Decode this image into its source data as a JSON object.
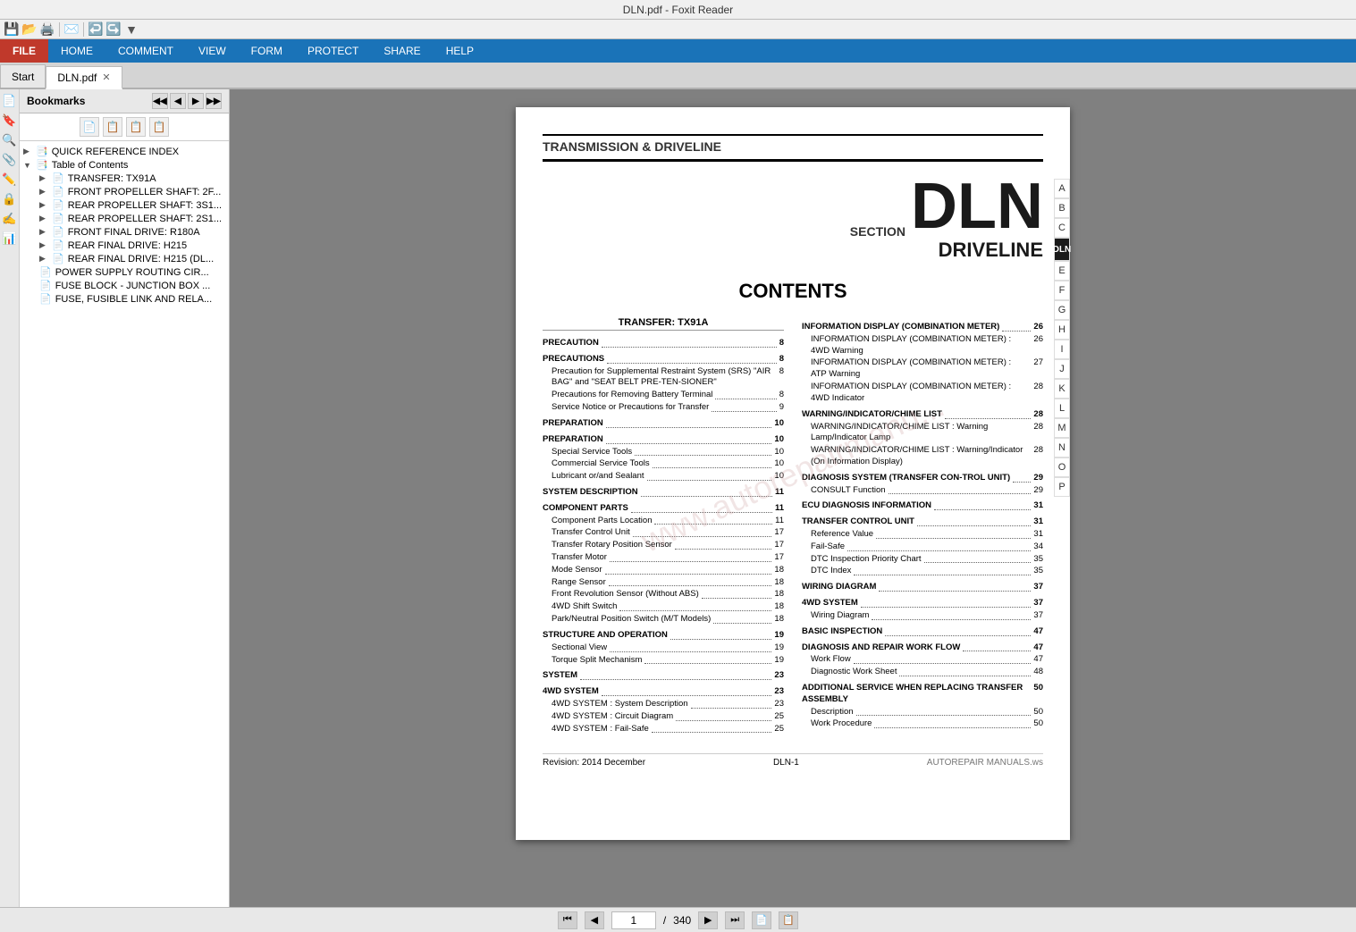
{
  "titleBar": {
    "text": "DLN.pdf - Foxit Reader"
  },
  "quickToolbar": {
    "icons": [
      "💾",
      "📂",
      "🖨️",
      "✉️",
      "↩️",
      "↪️",
      "▼"
    ]
  },
  "ribbon": {
    "file": "FILE",
    "tabs": [
      "HOME",
      "COMMENT",
      "VIEW",
      "FORM",
      "PROTECT",
      "SHARE",
      "HELP"
    ]
  },
  "tabs": [
    {
      "label": "Start",
      "active": false
    },
    {
      "label": "DLN.pdf",
      "active": true,
      "closeable": true
    }
  ],
  "sidebar": {
    "title": "Bookmarks",
    "navButtons": [
      "◀◀",
      "◀",
      "▶",
      "▶▶"
    ],
    "tools": [
      [
        "📄",
        "📋",
        "📋",
        "📋"
      ],
      []
    ],
    "tree": [
      {
        "indent": 0,
        "icon": "📑",
        "label": "QUICK REFERENCE INDEX",
        "expanded": false
      },
      {
        "indent": 0,
        "icon": "📑",
        "label": "Table of Contents",
        "expanded": true
      },
      {
        "indent": 1,
        "icon": "📄",
        "label": "TRANSFER: TX91A"
      },
      {
        "indent": 1,
        "icon": "📄",
        "label": "FRONT PROPELLER SHAFT: 2F..."
      },
      {
        "indent": 1,
        "icon": "📄",
        "label": "REAR PROPELLER SHAFT: 3S1..."
      },
      {
        "indent": 1,
        "icon": "📄",
        "label": "REAR PROPELLER SHAFT: 2S1..."
      },
      {
        "indent": 1,
        "icon": "📄",
        "label": "FRONT FINAL DRIVE: R180A"
      },
      {
        "indent": 1,
        "icon": "📄",
        "label": "REAR FINAL DRIVE: H215"
      },
      {
        "indent": 1,
        "icon": "📄",
        "label": "REAR FINAL DRIVE: H215 (DL..."
      },
      {
        "indent": 1,
        "icon": "📄",
        "label": "POWER SUPPLY ROUTING CIR..."
      },
      {
        "indent": 1,
        "icon": "📄",
        "label": "FUSE BLOCK - JUNCTION BOX ..."
      },
      {
        "indent": 1,
        "icon": "📄",
        "label": "FUSE, FUSIBLE LINK AND RELA..."
      }
    ]
  },
  "iconBar": {
    "icons": [
      "📄",
      "🔖",
      "🔍",
      "📎",
      "✏️",
      "🔒",
      "✍️",
      "📊"
    ]
  },
  "pdf": {
    "sectionLabel": "TRANSMISSION & DRIVELINE",
    "sectionWord": "SECTION",
    "dln": "DLN",
    "driveline": "DRIVELINE",
    "watermark": "www.autorepairmanu...",
    "contentsTitle": "CONTENTS",
    "rightLetters": [
      "A",
      "B",
      "C",
      "DLN",
      "E",
      "F",
      "G",
      "H",
      "I",
      "J",
      "K",
      "L",
      "M",
      "N",
      "O",
      "P"
    ],
    "leftCol": {
      "header": "TRANSFER: TX91A",
      "entries": [
        {
          "type": "main",
          "text": "PRECAUTION",
          "page": "8"
        },
        {
          "type": "main",
          "text": "PRECAUTIONS",
          "page": "8"
        },
        {
          "type": "sub",
          "text": "Precaution for Supplemental Restraint System (SRS) \"AIR BAG\" and \"SEAT BELT PRE-TEN-SIONER\"",
          "page": "8"
        },
        {
          "type": "sub",
          "text": "Precautions for Removing Battery Terminal",
          "page": "8"
        },
        {
          "type": "sub",
          "text": "Service Notice or Precautions for Transfer",
          "page": "9"
        },
        {
          "type": "main",
          "text": "PREPARATION",
          "page": "10"
        },
        {
          "type": "main",
          "text": "PREPARATION",
          "page": "10"
        },
        {
          "type": "sub",
          "text": "Special Service Tools",
          "page": "10"
        },
        {
          "type": "sub",
          "text": "Commercial Service Tools",
          "page": "10"
        },
        {
          "type": "sub",
          "text": "Lubricant or/and Sealant",
          "page": "10"
        },
        {
          "type": "main",
          "text": "SYSTEM DESCRIPTION",
          "page": "11"
        },
        {
          "type": "main",
          "text": "COMPONENT PARTS",
          "page": "11"
        },
        {
          "type": "sub",
          "text": "Component Parts Location",
          "page": "11"
        },
        {
          "type": "sub",
          "text": "Transfer Control Unit",
          "page": "17"
        },
        {
          "type": "sub",
          "text": "Transfer Rotary Position Sensor",
          "page": "17"
        },
        {
          "type": "sub",
          "text": "Transfer Motor",
          "page": "17"
        },
        {
          "type": "sub",
          "text": "Mode Sensor",
          "page": "18"
        },
        {
          "type": "sub",
          "text": "Range Sensor",
          "page": "18"
        },
        {
          "type": "sub",
          "text": "Front Revolution Sensor (Without ABS)",
          "page": "18"
        },
        {
          "type": "sub",
          "text": "4WD Shift Switch",
          "page": "18"
        },
        {
          "type": "sub",
          "text": "Park/Neutral Position Switch (M/T Models)",
          "page": "18"
        },
        {
          "type": "main",
          "text": "STRUCTURE AND OPERATION",
          "page": "19"
        },
        {
          "type": "sub",
          "text": "Sectional View",
          "page": "19"
        },
        {
          "type": "sub",
          "text": "Torque Split Mechanism",
          "page": "19"
        },
        {
          "type": "main",
          "text": "SYSTEM",
          "page": "23"
        },
        {
          "type": "main",
          "text": "4WD SYSTEM",
          "page": "23"
        },
        {
          "type": "sub",
          "text": "4WD SYSTEM : System Description",
          "page": "23"
        },
        {
          "type": "sub",
          "text": "4WD SYSTEM : Circuit Diagram",
          "page": "25"
        },
        {
          "type": "sub",
          "text": "4WD SYSTEM : Fail-Safe",
          "page": "25"
        }
      ]
    },
    "rightCol": {
      "entries": [
        {
          "type": "main",
          "text": "INFORMATION DISPLAY (COMBINATION METER)",
          "page": "26"
        },
        {
          "type": "sub",
          "text": "INFORMATION DISPLAY (COMBINATION METER) : 4WD Warning",
          "page": "26"
        },
        {
          "type": "sub",
          "text": "INFORMATION DISPLAY (COMBINATION METER) : ATP Warning",
          "page": "27"
        },
        {
          "type": "sub",
          "text": "INFORMATION DISPLAY (COMBINATION METER) : 4WD Indicator",
          "page": "28"
        },
        {
          "type": "main",
          "text": "WARNING/INDICATOR/CHIME LIST",
          "page": "28"
        },
        {
          "type": "sub",
          "text": "WARNING/INDICATOR/CHIME LIST : Warning Lamp/Indicator Lamp",
          "page": "28"
        },
        {
          "type": "sub",
          "text": "WARNING/INDICATOR/CHIME LIST : Warning/Indicator (On Information Display)",
          "page": "28"
        },
        {
          "type": "main",
          "text": "DIAGNOSIS SYSTEM (TRANSFER CONTROL UNIT)",
          "page": "29"
        },
        {
          "type": "sub",
          "text": "CONSULT Function",
          "page": "29"
        },
        {
          "type": "main",
          "text": "ECU DIAGNOSIS INFORMATION",
          "page": "31"
        },
        {
          "type": "main",
          "text": "TRANSFER CONTROL UNIT",
          "page": "31"
        },
        {
          "type": "sub",
          "text": "Reference Value",
          "page": "31"
        },
        {
          "type": "sub",
          "text": "Fail-Safe",
          "page": "34"
        },
        {
          "type": "sub",
          "text": "DTC Inspection Priority Chart",
          "page": "35"
        },
        {
          "type": "sub",
          "text": "DTC Index",
          "page": "35"
        },
        {
          "type": "main",
          "text": "WIRING DIAGRAM",
          "page": "37"
        },
        {
          "type": "main",
          "text": "4WD SYSTEM",
          "page": "37"
        },
        {
          "type": "sub",
          "text": "Wiring Diagram",
          "page": "37"
        },
        {
          "type": "main",
          "text": "BASIC INSPECTION",
          "page": "47"
        },
        {
          "type": "main",
          "text": "DIAGNOSIS AND REPAIR WORK FLOW",
          "page": "47"
        },
        {
          "type": "sub",
          "text": "Work Flow",
          "page": "47"
        },
        {
          "type": "sub",
          "text": "Diagnostic Work Sheet",
          "page": "48"
        },
        {
          "type": "main",
          "text": "ADDITIONAL SERVICE WHEN REPLACING TRANSFER ASSEMBLY",
          "page": "50"
        },
        {
          "type": "sub",
          "text": "Description",
          "page": "50"
        },
        {
          "type": "sub",
          "text": "Work Procedure",
          "page": "50"
        }
      ]
    },
    "footer": {
      "revision": "Revision: 2014 December",
      "pageLabel": "DLN-1"
    }
  },
  "statusBar": {
    "currentPage": "1",
    "totalPages": "340",
    "icons": [
      "⏮",
      "◀",
      "▶",
      "⏭",
      "📄",
      "📋"
    ]
  }
}
